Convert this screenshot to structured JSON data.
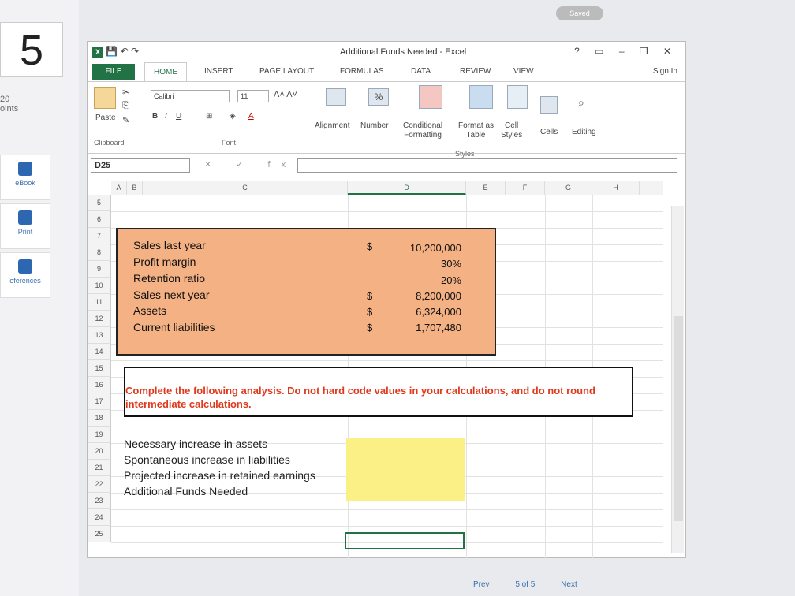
{
  "page": {
    "question_number": "5",
    "points_label": "20\noints",
    "saved_label": "Saved",
    "sidebar": [
      {
        "label": "eBook"
      },
      {
        "label": "Print"
      },
      {
        "label": "eferences"
      }
    ],
    "footer": {
      "prev": "Prev",
      "counter": "5 of 5",
      "next": "Next"
    }
  },
  "excel": {
    "title": "Additional Funds Needed - Excel",
    "window_controls": "? ▭ – ❐ ✕",
    "tabs": [
      "FILE",
      "HOME",
      "INSERT",
      "PAGE LAYOUT",
      "FORMULAS",
      "DATA",
      "REVIEW",
      "VIEW"
    ],
    "sign_in": "Sign In",
    "ribbon": {
      "paste": "Paste",
      "clipboard": "Clipboard",
      "font_name": "Calibri",
      "font_size": "11",
      "font_group": "Font",
      "bold": "B",
      "italic": "I",
      "underline": "U",
      "alignment": "Alignment",
      "number": "Number",
      "percent": "%",
      "conditional": "Conditional\nFormatting",
      "format_table": "Format as\nTable",
      "cell_styles": "Cell\nStyles",
      "styles_group": "Styles",
      "cells": "Cells",
      "editing": "Editing"
    },
    "name_box": "D25",
    "formula_icons": "✕ ✓ fx",
    "columns": [
      "A",
      "B",
      "C",
      "D",
      "E",
      "F",
      "G",
      "H",
      "I"
    ],
    "rows": [
      "5",
      "6",
      "7",
      "8",
      "9",
      "10",
      "11",
      "12",
      "13",
      "14",
      "15",
      "16",
      "17",
      "18",
      "19",
      "20",
      "21",
      "22",
      "23",
      "24",
      "25"
    ],
    "inputs": [
      {
        "label": "Sales last year",
        "dollar": "$",
        "value": "10,200,000"
      },
      {
        "label": "Profit margin",
        "dollar": "",
        "value": "30%"
      },
      {
        "label": "Retention ratio",
        "dollar": "",
        "value": "20%"
      },
      {
        "label": "Sales next year",
        "dollar": "$",
        "value": "8,200,000"
      },
      {
        "label": "Assets",
        "dollar": "$",
        "value": "6,324,000"
      },
      {
        "label": "Current liabilities",
        "dollar": "$",
        "value": "1,707,480"
      }
    ],
    "instruction": "Complete the following analysis. Do not hard code values in your calculations, and do not round intermediate calculations.",
    "analysis": [
      "Necessary increase in assets",
      "Spontaneous increase in liabilities",
      "Projected increase in retained earnings",
      "Additional Funds Needed"
    ]
  }
}
